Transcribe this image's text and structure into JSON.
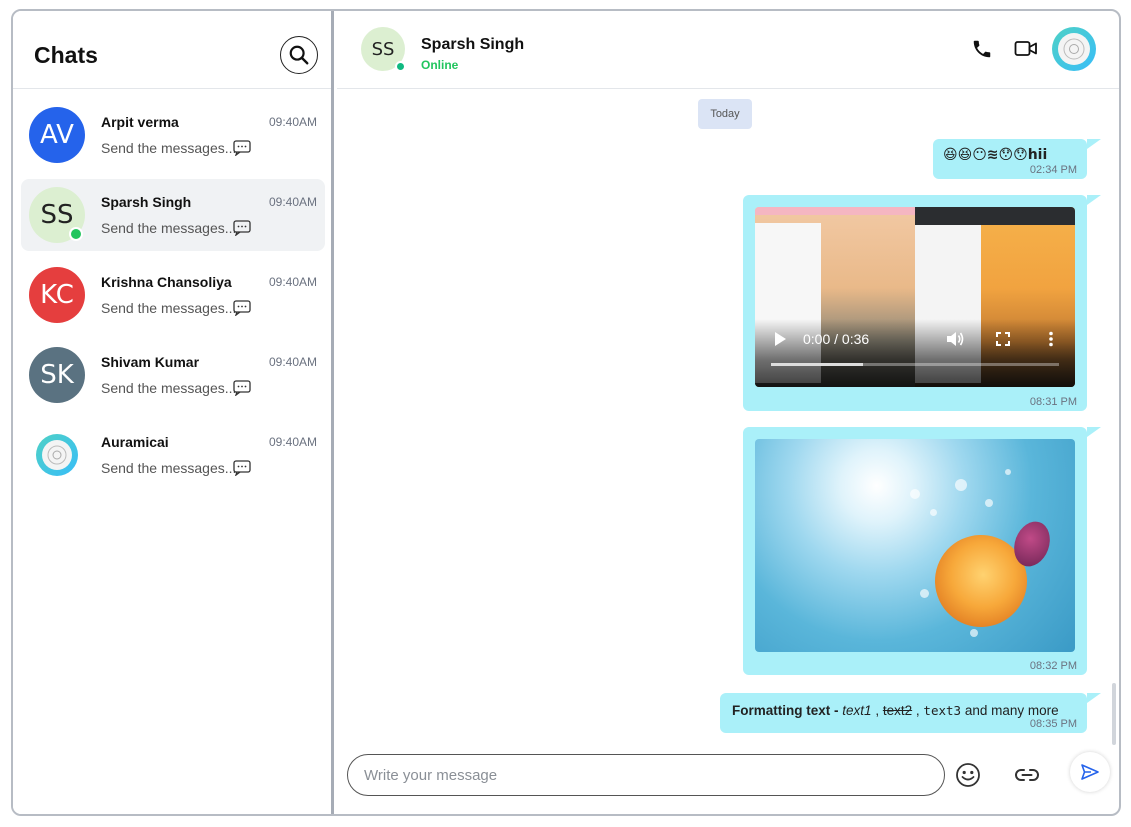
{
  "sidebar": {
    "title": "Chats",
    "chats": [
      {
        "initials": "AV",
        "name": "Arpit verma",
        "time": "09:40AM",
        "preview": "Send the messages...",
        "color": "#2563eb",
        "active": false,
        "online": false
      },
      {
        "initials": "SS",
        "name": "Sparsh Singh",
        "time": "09:40AM",
        "preview": "Send the messages...",
        "color": "#dcefd1",
        "active": true,
        "online": true
      },
      {
        "initials": "KC",
        "name": "Krishna Chansoliya",
        "time": "09:40AM",
        "preview": "Send the messages...",
        "color": "#e53e3e",
        "active": false,
        "online": false
      },
      {
        "initials": "SK",
        "name": "Shivam Kumar",
        "time": "09:40AM",
        "preview": "Send the messages...",
        "color": "#5a7281",
        "active": false,
        "online": false
      },
      {
        "initials": "",
        "name": "Auramicai",
        "time": "09:40AM",
        "preview": "Send the messages...",
        "color": "#38bdf8",
        "active": false,
        "online": false
      }
    ]
  },
  "header": {
    "initials": "SS",
    "name": "Sparsh Singh",
    "status": "Online"
  },
  "messages": {
    "date_divider": "Today",
    "items": [
      {
        "type": "text",
        "content": "😆😆😶≋😯😯hii",
        "time": "02:34 PM"
      },
      {
        "type": "video",
        "time_display": "0:00 / 0:36",
        "progress": 0.32,
        "time": "08:31 PM"
      },
      {
        "type": "image",
        "time": "08:32 PM"
      },
      {
        "type": "formatted",
        "bold": "Formatting text -",
        "italic": "text1",
        "sep1": ",",
        "strike": "text2",
        "sep2": ",",
        "mono": "text3",
        "rest": "and many more",
        "time": "08:35 PM"
      }
    ]
  },
  "composer": {
    "placeholder": "Write your message"
  },
  "colors": {
    "bubble": "#aaf0f9",
    "online": "#22c55e",
    "accent": "#2563eb"
  }
}
